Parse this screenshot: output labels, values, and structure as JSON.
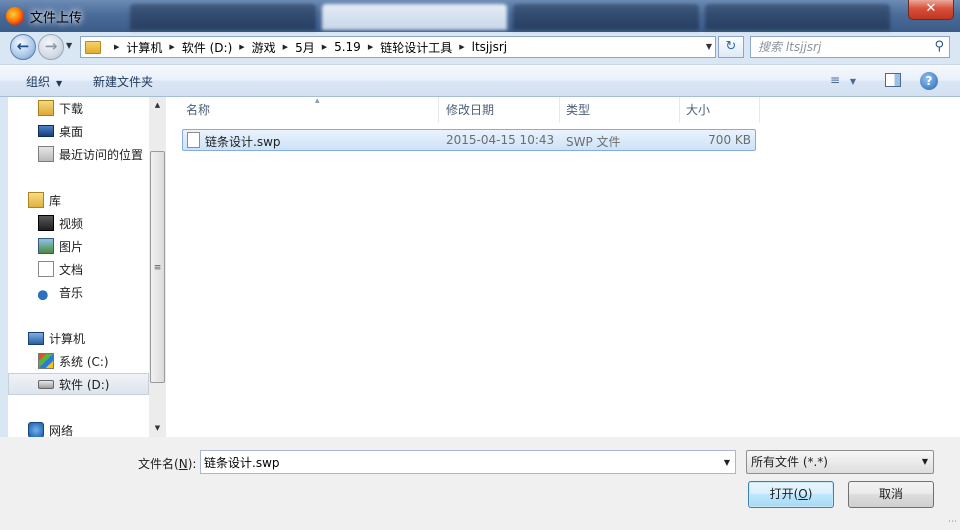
{
  "window": {
    "title": "文件上传",
    "close_label": "✕"
  },
  "address": {
    "breadcrumbs": [
      {
        "label": "计算机"
      },
      {
        "label": "软件 (D:)"
      },
      {
        "label": "游戏"
      },
      {
        "label": "5月"
      },
      {
        "label": "5.19"
      },
      {
        "label": "链轮设计工具"
      },
      {
        "label": "ltsjjsrj"
      }
    ]
  },
  "search": {
    "placeholder": "搜索 ltsjjsrj"
  },
  "toolbar": {
    "organize": "组织",
    "new_folder": "新建文件夹"
  },
  "nav": {
    "favorites": [
      {
        "label": "下载",
        "icon": "download-folder-icon"
      },
      {
        "label": "桌面",
        "icon": "desktop-icon"
      },
      {
        "label": "最近访问的位置",
        "icon": "recent-places-icon"
      }
    ],
    "libraries": {
      "label": "库",
      "icon": "library-icon"
    },
    "library_items": [
      {
        "label": "视频",
        "icon": "videos-icon"
      },
      {
        "label": "图片",
        "icon": "pictures-icon"
      },
      {
        "label": "文档",
        "icon": "documents-icon"
      },
      {
        "label": "音乐",
        "icon": "music-icon"
      }
    ],
    "computer": {
      "label": "计算机",
      "icon": "computer-icon"
    },
    "drives": [
      {
        "label": "系统 (C:)",
        "icon": "system-drive-icon"
      },
      {
        "label": "软件 (D:)",
        "icon": "drive-icon",
        "selected": true
      }
    ],
    "network": {
      "label": "网络",
      "icon": "network-icon"
    }
  },
  "columns": {
    "name": "名称",
    "date": "修改日期",
    "type": "类型",
    "size": "大小"
  },
  "files": [
    {
      "name": "链条设计.swp",
      "date": "2015-04-15 10:43",
      "type": "SWP 文件",
      "size": "700 KB",
      "selected": true
    }
  ],
  "bottom": {
    "filename_label": "文件名",
    "filename_accel": "N",
    "filename_value": "链条设计.swp",
    "filetype_value": "所有文件 (*.*)",
    "open_label": "打开",
    "open_accel": "O",
    "cancel_label": "取消"
  },
  "colors": {
    "accent": "#3c7fb1",
    "selection": "#cde2f8",
    "titlebar": "#4b6c99"
  }
}
